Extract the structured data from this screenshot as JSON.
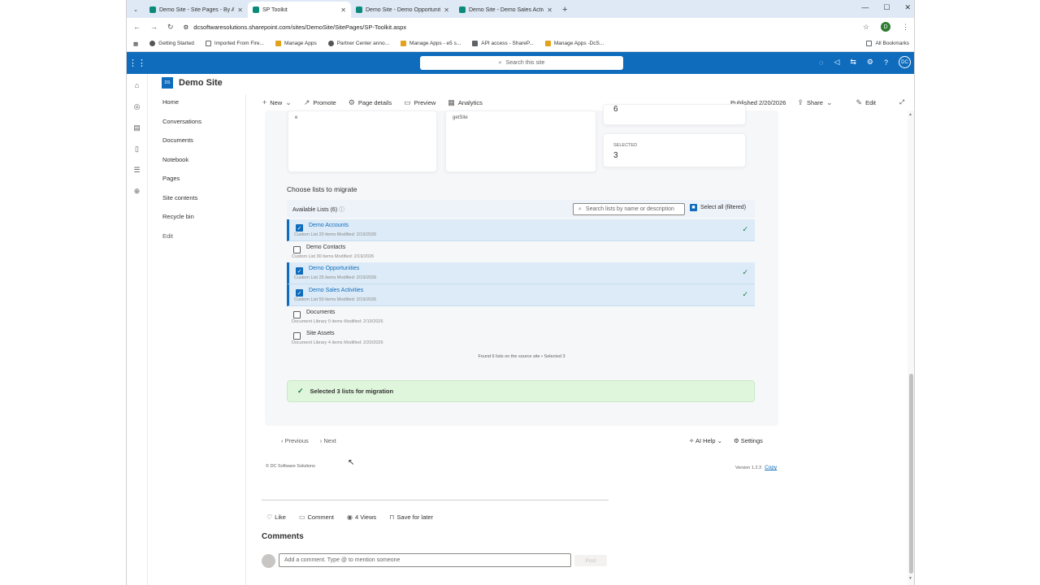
{
  "browser": {
    "tabs": [
      {
        "title": "Demo Site - Site Pages - By Au",
        "active": false
      },
      {
        "title": "SP Toolkit",
        "active": true
      },
      {
        "title": "Demo Site - Demo Opportuniti",
        "active": false
      },
      {
        "title": "Demo Site - Demo Sales Activi",
        "active": false
      }
    ],
    "url": "dcsoftwaresolutions.sharepoint.com/sites/DemoSite/SitePages/SP-Toolkit.aspx",
    "profile_initial": "D",
    "bookmarks": [
      "Getting Started",
      "Imported From Fire...",
      "Manage Apps",
      "Partner Center anno...",
      "Manage Apps - e5 s...",
      "API access - ShareP...",
      "Manage Apps -DcS..."
    ],
    "all_bookmarks": "All Bookmarks"
  },
  "suite": {
    "search_placeholder": "Search this site",
    "avatar_initials": "DC"
  },
  "site": {
    "logo": "DS",
    "name": "Demo Site",
    "nav": [
      "Home",
      "Conversations",
      "Documents",
      "Notebook",
      "Pages",
      "Site contents",
      "Recycle bin",
      "Edit"
    ]
  },
  "command_bar": {
    "new": "New",
    "promote": "Promote",
    "page_details": "Page details",
    "preview": "Preview",
    "analytics": "Analytics",
    "published": "Published 2/20/2026",
    "share": "Share",
    "edit": "Edit"
  },
  "cards": {
    "card1_text": "e",
    "card2_text": "getSite",
    "stat1_value": "6",
    "stat2_label": "SELECTED",
    "stat2_value": "3"
  },
  "migration": {
    "title": "Choose lists to migrate",
    "available": "Available Lists (6)",
    "search_placeholder": "Search lists by name or description",
    "select_all": "Select all (filtered)",
    "lists": [
      {
        "name": "Demo Accounts",
        "meta": "Custom List   20 items   Modified: 2/19/2026",
        "selected": true
      },
      {
        "name": "Demo Contacts",
        "meta": "Custom List   30 items   Modified: 2/19/2026",
        "selected": false
      },
      {
        "name": "Demo Opportunities",
        "meta": "Custom List   25 items   Modified: 2/19/2026",
        "selected": true
      },
      {
        "name": "Demo Sales Activities",
        "meta": "Custom List   50 items   Modified: 2/19/2026",
        "selected": true
      },
      {
        "name": "Documents",
        "meta": "Document Library   0 items   Modified: 2/19/2026",
        "selected": false
      },
      {
        "name": "Site Assets",
        "meta": "Document Library   4 items   Modified: 2/20/2026",
        "selected": false
      }
    ],
    "found_text": "Found 6 lists on the source site • Selected 3",
    "success": "Selected 3 lists for migration"
  },
  "pager": {
    "previous": "Previous",
    "next": "Next"
  },
  "help": {
    "ai_help": "AI Help",
    "settings": "Settings"
  },
  "footer": {
    "copyright": "© DC Software Solutions",
    "version": "Version 1.2.3",
    "copy": "Copy"
  },
  "social": {
    "like": "Like",
    "comment": "Comment",
    "views": "4 Views",
    "save": "Save for later"
  },
  "comments": {
    "title": "Comments",
    "placeholder": "Add a comment. Type @ to mention someone",
    "post": "Post"
  },
  "colors": {
    "brand": "#0f6cbd",
    "success_bg": "#dff6dd",
    "selected_row": "#dcebf7"
  }
}
